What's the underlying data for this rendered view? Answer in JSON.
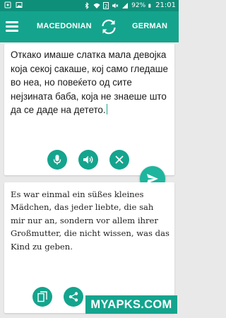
{
  "status_bar": {
    "battery": "92%",
    "time": "21:01",
    "sim_slot": "2",
    "icons": [
      "android-icon",
      "image-icon",
      "bluetooth-icon",
      "wifi-icon",
      "sim-2-icon",
      "mute-icon",
      "signal-icon",
      "battery-icon"
    ]
  },
  "toolbar": {
    "source_language": "MACEDONIAN",
    "target_language": "GERMAN"
  },
  "source": {
    "text": "Откако имаше слатка мала девојка која секој сакаше, кој само гледаше во неа, но повеќето од сите нејзината баба, која не знаеше што да се даде на детето."
  },
  "translation": {
    "text": "Es war einmal ein süßes kleines Mädchen, das jeder liebte, die sah mir nur an, sondern vor allem ihrer Großmutter, die nicht wissen, was das Kind zu geben."
  },
  "watermark": "MYAPKS.COM",
  "colors": {
    "primary": "#14a48d",
    "status_bar": "#0e8f7a",
    "background": "#e9e9e9",
    "accent": "#1eb59e"
  }
}
